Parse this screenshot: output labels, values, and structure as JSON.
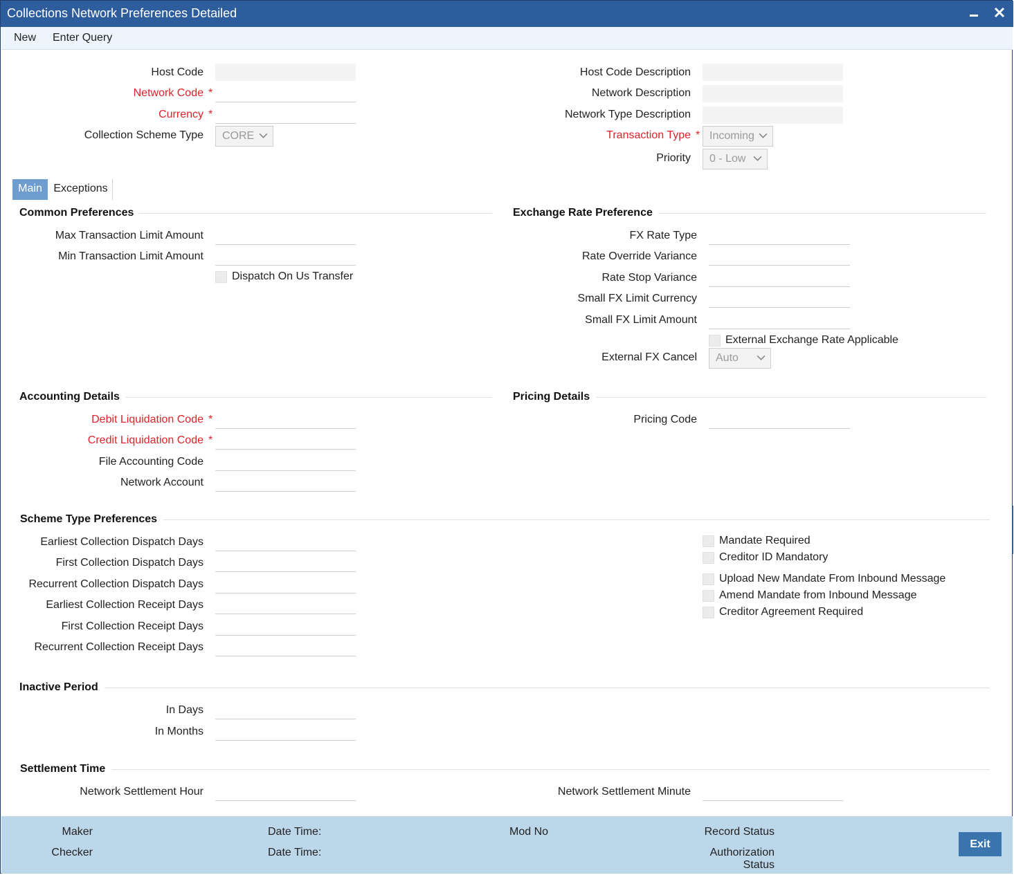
{
  "window": {
    "title": "Collections Network Preferences Detailed"
  },
  "menu": {
    "items": [
      "New",
      "Enter Query"
    ]
  },
  "header": {
    "host_code": "Host Code",
    "network_code": "Network Code",
    "currency": "Currency",
    "collection_scheme_type": "Collection Scheme Type",
    "collection_scheme_value": "CORE",
    "host_code_description": "Host Code Description",
    "network_description": "Network Description",
    "network_type_description": "Network Type Description",
    "transaction_type": "Transaction Type",
    "transaction_type_value": "Incoming",
    "priority": "Priority",
    "priority_value": "0 - Low",
    "required_mark": "*"
  },
  "tabs": [
    "Main",
    "Exceptions"
  ],
  "common_preferences": {
    "title": "Common Preferences",
    "max_limit": "Max Transaction Limit Amount",
    "min_limit": "Min Transaction Limit Amount",
    "dispatch_on_us": "Dispatch On Us Transfer"
  },
  "exchange_rate": {
    "title": "Exchange Rate Preference",
    "fx_rate_type": "FX Rate Type",
    "rate_override_variance": "Rate Override Variance",
    "rate_stop_variance": "Rate Stop Variance",
    "small_fx_limit_currency": "Small FX Limit Currency",
    "small_fx_limit_amount": "Small FX Limit Amount",
    "external_rate_applicable": "External Exchange Rate Applicable",
    "external_fx_cancel": "External FX Cancel",
    "external_fx_cancel_value": "Auto"
  },
  "accounting": {
    "title": "Accounting Details",
    "debit_liquidation_code": "Debit Liquidation Code",
    "credit_liquidation_code": "Credit Liquidation Code",
    "file_accounting_code": "File Accounting Code",
    "network_account": "Network Account"
  },
  "pricing": {
    "title": "Pricing Details",
    "pricing_code": "Pricing Code"
  },
  "scheme_type": {
    "title": "Scheme Type Preferences",
    "earliest_dispatch": "Earliest Collection Dispatch Days",
    "first_dispatch": "First Collection Dispatch Days",
    "recurrent_dispatch": "Recurrent Collection Dispatch Days",
    "earliest_receipt": "Earliest Collection Receipt Days",
    "first_receipt": "First Collection Receipt Days",
    "recurrent_receipt": "Recurrent Collection Receipt Days",
    "mandate_required": "Mandate Required",
    "creditor_id_mandatory": "Creditor ID Mandatory",
    "upload_new_mandate": "Upload New Mandate From Inbound Message",
    "amend_mandate": "Amend Mandate from Inbound Message",
    "creditor_agreement_required": "Creditor Agreement Required"
  },
  "inactive_period": {
    "title": "Inactive Period",
    "in_days": "In Days",
    "in_months": "In Months"
  },
  "settlement_time": {
    "title": "Settlement Time",
    "hour": "Network Settlement Hour",
    "minute": "Network Settlement Minute"
  },
  "footer": {
    "maker": "Maker",
    "checker": "Checker",
    "date_time_1": "Date Time:",
    "date_time_2": "Date Time:",
    "mod_no": "Mod No",
    "record_status": "Record Status",
    "authorization_line1": "Authorization",
    "authorization_line2": "Status",
    "exit": "Exit"
  },
  "colors": {
    "title_bar": "#2e5d9e",
    "required": "#e0222a",
    "footer": "#bcd6ea",
    "active_tab": "#6e9ed0",
    "exit_button": "#3a76ad"
  }
}
